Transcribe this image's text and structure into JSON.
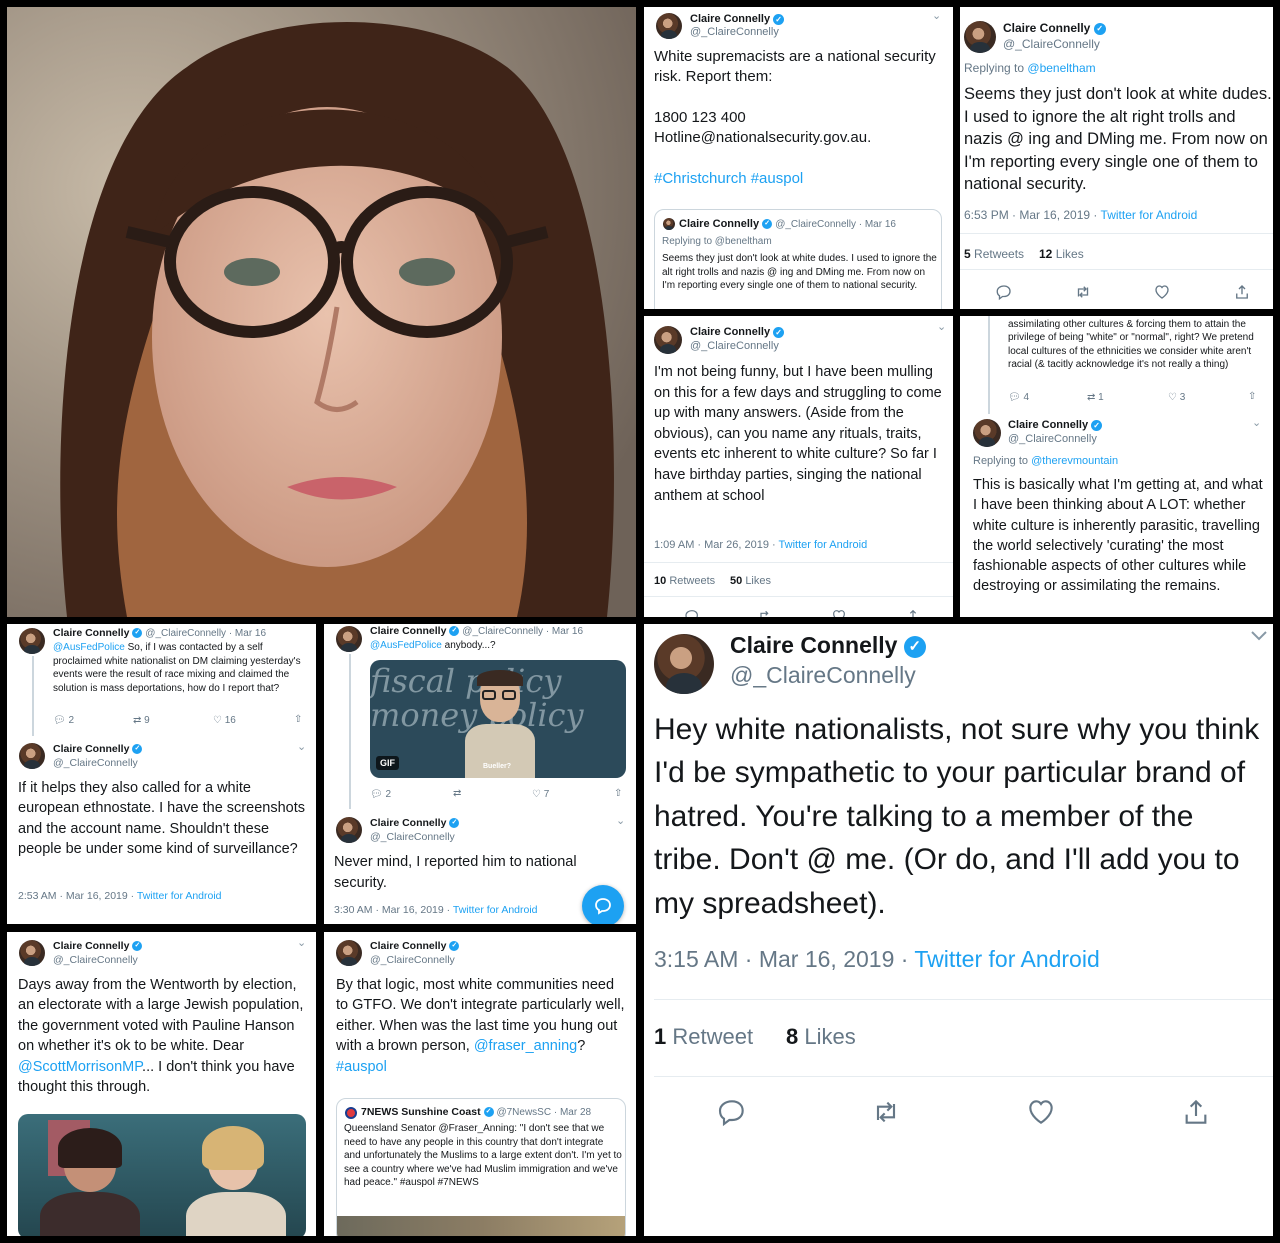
{
  "colors": {
    "link": "#1da1f2",
    "text": "#14171a",
    "muted": "#657786",
    "verified": "#1da1f2"
  },
  "user": {
    "name": "Claire Connelly",
    "handle": "@_ClaireConnelly"
  },
  "icons": [
    "verified-badge-icon",
    "chevron-down-icon",
    "reply-icon",
    "retweet-icon",
    "like-icon",
    "share-icon",
    "compose-icon"
  ],
  "tweet1": {
    "text": "White supremacists are a national security risk. Report them:",
    "phone": "1800 123 400",
    "email": "Hotline@nationalsecurity.gov.au.",
    "hashtags": "#Christchurch #auspol",
    "quote": {
      "name": "Claire Connelly",
      "meta": "@_ClaireConnelly · Mar 16",
      "replying": "Replying to @beneltham",
      "text": "Seems they just don't look at white dudes. I used to ignore the alt right trolls and nazis @ ing and DMing me. From now on I'm reporting every single one of them to national security."
    }
  },
  "tweet2": {
    "replying_prefix": "Replying to",
    "replying_to": "@beneltham",
    "text": "Seems they just don't look at white dudes. I used to ignore the alt right trolls and nazis @ ing and DMing me. From now on I'm reporting every single one of them to national security.",
    "time": "6:53 PM · Mar 16, 2019 ·",
    "source": "Twitter for Android",
    "retweets_count": "5",
    "retweets_label": "Retweets",
    "likes_count": "12",
    "likes_label": "Likes"
  },
  "tweet3": {
    "text": "I'm not being funny, but I have been mulling on this for a few days and struggling to come up with many answers. (Aside from the obvious), can you name any rituals, traits, events etc inherent to white culture? So far I have birthday parties, singing the national anthem at school",
    "time": "1:09 AM · Mar 26, 2019 ·",
    "source": "Twitter for Android",
    "retweets_count": "10",
    "retweets_label": "Retweets",
    "likes_count": "50",
    "likes_label": "Likes"
  },
  "tweet4": {
    "prev_text": "assimilating other cultures & forcing them to attain the privilege of being \"white\" or \"normal\", right? We pretend local cultures of the ethnicities we consider white aren't racial (& tacitly acknowledge it's not really a thing)",
    "prev_replies": "4",
    "prev_retweets": "1",
    "prev_likes": "3",
    "replying_prefix": "Replying to",
    "replying_to": "@therevmountain",
    "text": "This is basically what I'm getting at, and what I have been thinking about A LOT: whether white culture is inherently parasitic, travelling the world selectively 'curating' the most fashionable aspects of other cultures while destroying or assimilating the remains."
  },
  "tweet5": {
    "meta": "@_ClaireConnelly · Mar 16",
    "mention": "@AusFedPolice",
    "prev_text": "So, if I was contacted by a self proclaimed white nationalist on DM claiming yesterday's events were the result of race mixing and claimed the solution is mass deportations, how do I report that?",
    "prev_replies": "2",
    "prev_retweets": "9",
    "prev_likes": "16",
    "text": "If it helps they also called for a white european ethnostate. I have the screenshots and the account name. Shouldn't these people be under some kind of surveillance?",
    "time": "2:53 AM · Mar 16, 2019 ·",
    "source": "Twitter for Android"
  },
  "tweet6": {
    "meta": "@_ClaireConnelly · Mar 16",
    "mention": "@AusFedPolice",
    "prev_text": "anybody...?",
    "gif_label": "GIF",
    "gif_caption": "Bueller?",
    "gif_board_text": "fiscal policy money policy",
    "prev_replies": "2",
    "prev_likes": "7",
    "text": "Never mind, I reported him to national security.",
    "time": "3:30 AM · Mar 16, 2019 ·",
    "source": "Twitter for Android"
  },
  "tweet7": {
    "text_before": "Days away from the Wentworth by election, an electorate with a large Jewish population, the government voted with Pauline Hanson on whether it's ok to be white. Dear ",
    "mention": "@ScottMorrisonMP",
    "text_after": "... I don't think you have thought this through."
  },
  "tweet8": {
    "text_before": "By that logic, most white communities need to GTFO. We don't integrate particularly well, either. When was the last time you hung out with a brown person, ",
    "mention": "@fraser_anning",
    "text_mid": "? ",
    "hashtag": "#auspol",
    "quote": {
      "name": "7NEWS Sunshine Coast",
      "meta": "@7NewsSC · Mar 28",
      "text": "Queensland Senator @Fraser_Anning: \"I don't see that we need to have any people in this country that don't integrate and unfortunately the Muslims to a large extent don't. I'm yet to see a country where we've had Muslim immigration and we've had peace.\" #auspol #7NEWS"
    }
  },
  "tweet9": {
    "text": "Hey white nationalists, not sure why you think I'd be sympathetic to your particular brand of hatred. You're talking to a member of the tribe. Don't @ me. (Or do, and I'll add you to my spreadsheet).",
    "time": "3:15 AM · Mar 16, 2019 ·",
    "source": "Twitter for Android",
    "retweets_count": "1",
    "retweets_label": "Retweet",
    "likes_count": "8",
    "likes_label": "Likes"
  }
}
